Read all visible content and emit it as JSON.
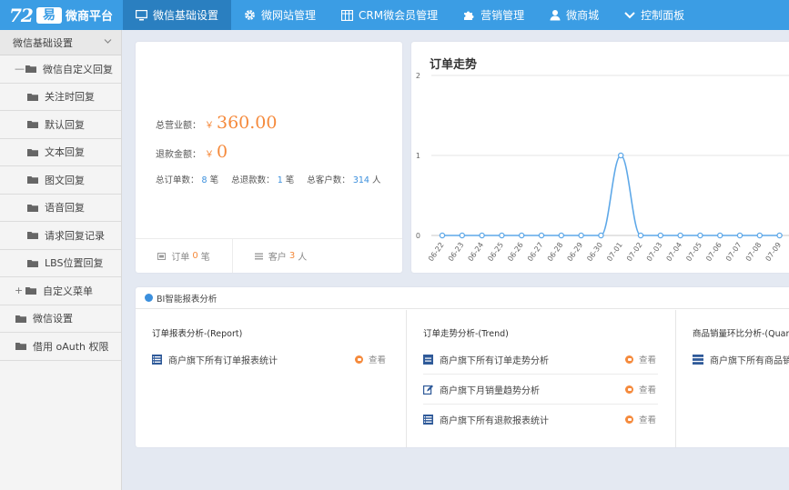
{
  "app": {
    "logo_number": "72",
    "logo_badge": "易",
    "logo_text": "微商平台"
  },
  "nav": {
    "items": [
      {
        "label": "微信基础设置",
        "icon": "monitor-icon",
        "active": true
      },
      {
        "label": "微网站管理",
        "icon": "gear-icon"
      },
      {
        "label": "CRM微会员管理",
        "icon": "grid-icon"
      },
      {
        "label": "营销管理",
        "icon": "puzzle-icon"
      },
      {
        "label": "微商城",
        "icon": "user-icon"
      },
      {
        "label": "控制面板",
        "icon": "chevron-down-icon"
      }
    ]
  },
  "sidebar": {
    "header": "微信基础设置",
    "items": [
      {
        "label": "微信自定义回复",
        "level": 1,
        "toggle": "—"
      },
      {
        "label": "关注时回复",
        "level": 2
      },
      {
        "label": "默认回复",
        "level": 2
      },
      {
        "label": "文本回复",
        "level": 2
      },
      {
        "label": "图文回复",
        "level": 2
      },
      {
        "label": "语音回复",
        "level": 2
      },
      {
        "label": "请求回复记录",
        "level": 2
      },
      {
        "label": "LBS位置回复",
        "level": 2
      },
      {
        "label": "自定义菜单",
        "level": 1,
        "toggle": "+"
      },
      {
        "label": "微信设置",
        "level": 0
      },
      {
        "label": "借用 oAuth 权限",
        "level": 0
      }
    ]
  },
  "stats": {
    "revenue_label": "总营业额：",
    "revenue_currency": "￥",
    "revenue_value": "360.00",
    "refund_label": "退款金额：",
    "refund_currency": "￥",
    "refund_value": "0",
    "orders_label": "总订单数：",
    "orders_value": "8",
    "orders_unit": "笔",
    "refunds_label": "总退款数：",
    "refunds_value": "1",
    "refunds_unit": "笔",
    "customers_label": "总客户数：",
    "customers_value": "314",
    "customers_unit": "人",
    "footer": {
      "orders_label": "订单",
      "orders_value": "0",
      "orders_unit": "笔",
      "customers_label": "客户",
      "customers_value": "3",
      "customers_unit": "人"
    }
  },
  "chart_data": {
    "type": "line",
    "title": "订单走势",
    "categories": [
      "06-22",
      "06-23",
      "06-24",
      "06-25",
      "06-26",
      "06-27",
      "06-28",
      "06-29",
      "06-30",
      "07-01",
      "07-02",
      "07-03",
      "07-04",
      "07-05",
      "07-06",
      "07-07",
      "07-08",
      "07-09"
    ],
    "series": [
      {
        "values": [
          0,
          0,
          0,
          0,
          0,
          0,
          0,
          0,
          0,
          1,
          0,
          0,
          0,
          0,
          0,
          0,
          0,
          0
        ]
      }
    ],
    "ylim": [
      0,
      2
    ],
    "yticks": [
      "0",
      "1",
      "2"
    ],
    "grid": true,
    "smooth": true,
    "color": "#5ea8e8"
  },
  "bi": {
    "header": "BI智能报表分析",
    "view_label": "查看",
    "columns": [
      {
        "title": "订单报表分析-(Report)",
        "rows": [
          {
            "label": "商户旗下所有订单报表统计",
            "icon": "list-icon"
          }
        ]
      },
      {
        "title": "订单走势分析-(Trend)",
        "rows": [
          {
            "label": "商户旗下所有订单走势分析",
            "icon": "report-icon"
          },
          {
            "label": "商户旗下月销量趋势分析",
            "icon": "edit-icon"
          },
          {
            "label": "商户旗下所有退款报表统计",
            "icon": "list-icon"
          }
        ]
      },
      {
        "title": "商品销量环比分析-(Quarte",
        "rows": [
          {
            "label": "商户旗下所有商品销",
            "icon": "stack-icon"
          }
        ]
      }
    ]
  }
}
